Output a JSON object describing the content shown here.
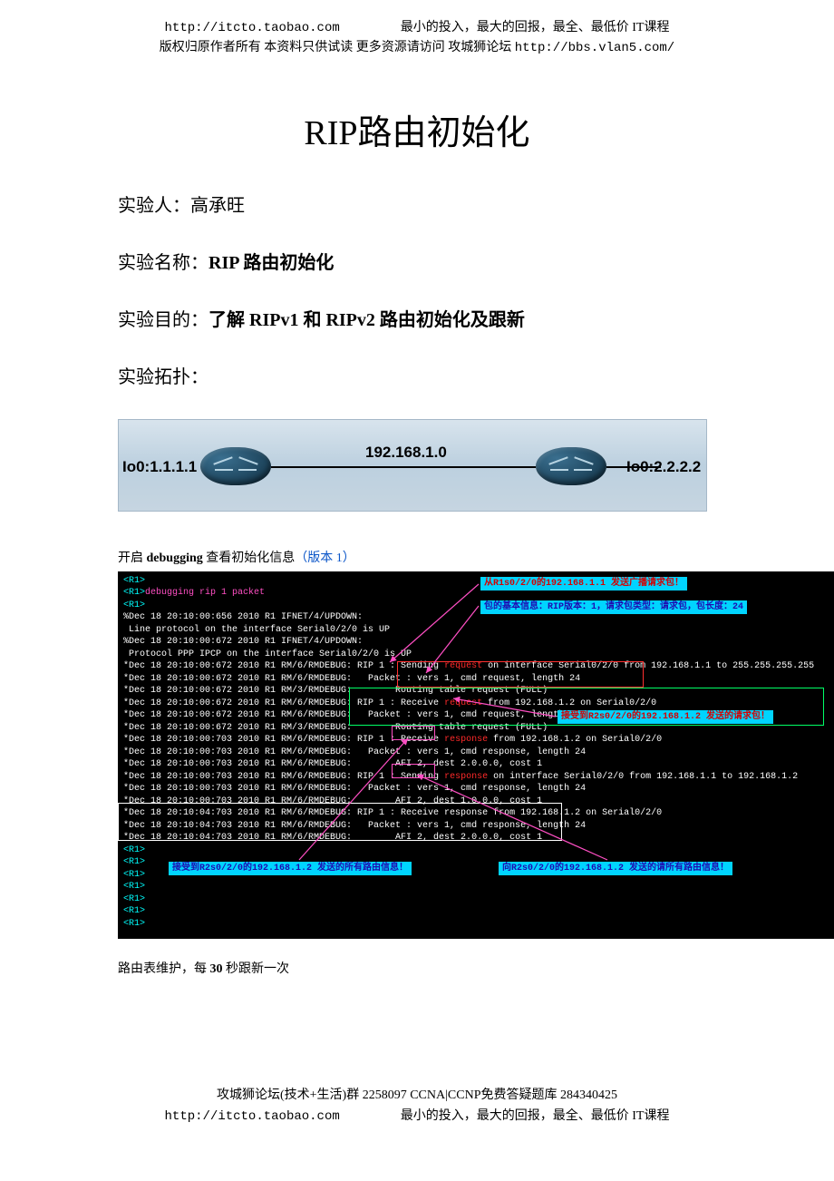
{
  "header": {
    "url1": "http://itcto.taobao.com",
    "slogan1": "最小的投入，最大的回报，最全、最低价 IT课程",
    "line2_prefix": "版权归原作者所有 本资料只供试读 更多资源请访问 攻城狮论坛 ",
    "url2": "http://bbs.vlan5.com/"
  },
  "title": "RIP路由初始化",
  "fields": {
    "experimenter_label": "实验人：",
    "experimenter_value": "高承旺",
    "name_label": "实验名称：",
    "name_value": "RIP 路由初始化",
    "goal_label": "实验目的：",
    "goal_value": "了解 RIPv1 和 RIPv2 路由初始化及跟新",
    "topo_label": "实验拓扑："
  },
  "topology": {
    "left": "Io0:1.1.1.1",
    "mid": "192.168.1.0",
    "right": "Io0:2.2.2.2"
  },
  "subhead": {
    "pre": "开启 ",
    "bold": "debugging",
    "post": " 查看初始化信息",
    "ver": "（版本 1）"
  },
  "terminal": {
    "lines": [
      {
        "t": "<R1>",
        "cls": "cyan"
      },
      {
        "t": "debugging rip 1 packet",
        "cls": "pink",
        "prefix": "<R1>"
      },
      {
        "t": "<R1>",
        "cls": "cyan"
      },
      {
        "t": "%Dec 18 20:10:00:656 2010 R1 IFNET/4/UPDOWN:",
        "cls": ""
      },
      {
        "t": " Line protocol on the interface Serial0/2/0 is UP",
        "cls": ""
      },
      {
        "t": "%Dec 18 20:10:00:672 2010 R1 IFNET/4/UPDOWN:",
        "cls": ""
      },
      {
        "t": " Protocol PPP IPCP on the interface Serial0/2/0 is UP",
        "cls": ""
      },
      {
        "t": "*Dec 18 20:10:00:672 2010 R1 RM/6/RMDEBUG: RIP 1 : Sending ",
        "cls": "",
        "append": {
          "t": "request",
          "cls": "red"
        },
        "append2": " on interface Serial0/2/0 from 192.168.1.1 to 255.255.255.255"
      },
      {
        "t": "*Dec 18 20:10:00:672 2010 R1 RM/6/RMDEBUG:   Packet : vers 1, cmd request, length 24",
        "cls": ""
      },
      {
        "t": "*Dec 18 20:10:00:672 2010 R1 RM/3/RMDEBUG:        Routing table request (FULL)",
        "cls": ""
      },
      {
        "t": "*Dec 18 20:10:00:672 2010 R1 RM/6/RMDEBUG: RIP 1 : Receive ",
        "cls": "",
        "append": {
          "t": "request",
          "cls": "red"
        },
        "append2": " from 192.168.1.2 on Serial0/2/0"
      },
      {
        "t": "*Dec 18 20:10:00:672 2010 R1 RM/6/RMDEBUG:   Packet : vers 1, cmd request, length 24",
        "cls": ""
      },
      {
        "t": "*Dec 18 20:10:00:672 2010 R1 RM/3/RMDEBUG:        Routing table request (FULL)",
        "cls": ""
      },
      {
        "t": "*Dec 18 20:10:00:703 2010 R1 RM/6/RMDEBUG: RIP 1 : ",
        "cls": "",
        "box": "Receive",
        "append": {
          "t": "response",
          "cls": "red"
        },
        "append2": " from 192.168.1.2 on Serial0/2/0"
      },
      {
        "t": "*Dec 18 20:10:00:703 2010 R1 RM/6/RMDEBUG:   Packet : vers 1, cmd response, length 24",
        "cls": ""
      },
      {
        "t": "*Dec 18 20:10:00:703 2010 R1 RM/6/RMDEBUG:        AFI 2, dest 2.0.0.0, cost 1",
        "cls": ""
      },
      {
        "t": "*Dec 18 20:10:00:703 2010 R1 RM/6/RMDEBUG: RIP 1 : ",
        "cls": "",
        "box": "Sending",
        "append": {
          "t": "response",
          "cls": "red"
        },
        "append2": " on interface Serial0/2/0 from 192.168.1.1 to 192.168.1.2"
      },
      {
        "t": "*Dec 18 20:10:00:703 2010 R1 RM/6/RMDEBUG:   Packet : vers 1, cmd response, length 24",
        "cls": ""
      },
      {
        "t": "*Dec 18 20:10:00:703 2010 R1 RM/6/RMDEBUG:        AFI 2, dest 1.0.0.0, cost 1",
        "cls": ""
      },
      {
        "t": "*Dec 18 20:10:04:703 2010 R1 RM/6/RMDEBUG: RIP 1 : Receive response from 192.168.1.2 on Serial0/2/0",
        "cls": ""
      },
      {
        "t": "*Dec 18 20:10:04:703 2010 R1 RM/6/RMDEBUG:   Packet : vers 1, cmd response, length 24",
        "cls": ""
      },
      {
        "t": "*Dec 18 20:10:04:703 2010 R1 RM/6/RMDEBUG:        AFI 2, dest 2.0.0.0, cost 1",
        "cls": ""
      },
      {
        "t": "<R1>",
        "cls": "cyan"
      },
      {
        "t": "<R1>",
        "cls": "cyan"
      },
      {
        "t": "<R1>",
        "cls": "cyan"
      },
      {
        "t": "<R1>",
        "cls": "cyan"
      },
      {
        "t": "<R1>",
        "cls": "cyan"
      },
      {
        "t": "<R1>",
        "cls": "cyan"
      },
      {
        "t": "<R1>",
        "cls": "cyan"
      }
    ],
    "callouts": {
      "c1": "从R1s0/2/0的192.168.1.1 发送广播请求包！",
      "c2": "包的基本信息：RIP版本：1，请求包类型：请求包，包长度：24",
      "c3": "接受到R2s0/2/0的192.168.1.2 发送的请求包！",
      "c4": "接受到R2s0/2/0的192.168.1.2 发送的所有路由信息！",
      "c5": "向R2s0/2/0的192.168.1.2 发送的请所有路由信息！"
    }
  },
  "rt_maint": {
    "pre": "路由表维护，每 ",
    "bold": "30",
    "post": " 秒跟新一次"
  },
  "footer": {
    "line1": "攻城狮论坛(技术+生活)群 2258097 CCNA|CCNP免费答疑题库 284340425",
    "url1": "http://itcto.taobao.com",
    "slogan": "最小的投入，最大的回报，最全、最低价 IT课程"
  }
}
